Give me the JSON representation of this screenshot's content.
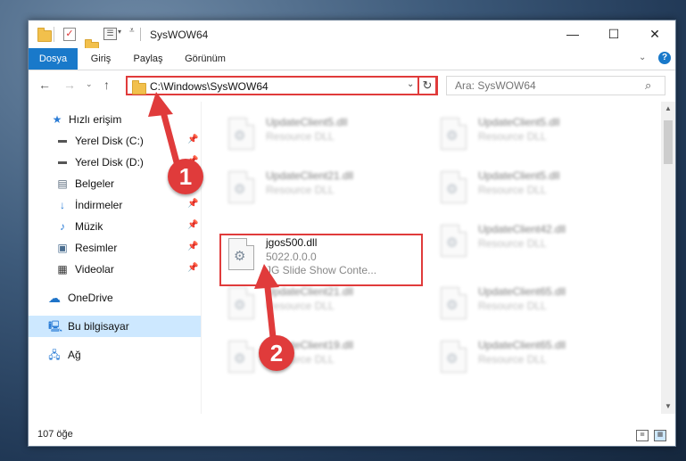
{
  "window": {
    "title": "SysWOW64",
    "controls": {
      "minimize": "—",
      "maximize": "☐",
      "close": "✕"
    }
  },
  "ribbon": {
    "tabs": [
      {
        "label": "Dosya",
        "active": true
      },
      {
        "label": "Giriş"
      },
      {
        "label": "Paylaş"
      },
      {
        "label": "Görünüm"
      }
    ],
    "help": "?"
  },
  "toolbar": {
    "address": "C:\\Windows\\SysWOW64",
    "search_placeholder": "Ara: SysWOW64"
  },
  "nav": {
    "items": [
      {
        "label": "Hızlı erişim",
        "icon": "star-icon"
      },
      {
        "label": "Yerel Disk (C:)",
        "icon": "drive-icon",
        "pinned": true
      },
      {
        "label": "Yerel Disk (D:)",
        "icon": "drive-icon",
        "pinned": true
      },
      {
        "label": "Belgeler",
        "icon": "document-icon",
        "pinned": true
      },
      {
        "label": "İndirmeler",
        "icon": "download-icon",
        "pinned": true
      },
      {
        "label": "Müzik",
        "icon": "music-icon",
        "pinned": true
      },
      {
        "label": "Resimler",
        "icon": "pictures-icon",
        "pinned": true
      },
      {
        "label": "Videolar",
        "icon": "video-icon",
        "pinned": true
      },
      {
        "label": "OneDrive",
        "icon": "cloud-icon"
      },
      {
        "label": "Bu bilgisayar",
        "icon": "computer-icon",
        "selected": true
      },
      {
        "label": "Ağ",
        "icon": "network-icon"
      }
    ]
  },
  "files": [
    {
      "name": "UpdateClient5.dll",
      "desc": "Resource DLL"
    },
    {
      "name": "UpdateClient5.dll",
      "desc": "Resource DLL"
    },
    {
      "name": "UpdateClient21.dll",
      "desc": "Resource DLL"
    },
    {
      "name": "UpdateClient5.dll",
      "desc": "Resource DLL"
    },
    {
      "name": "jgos500.dll",
      "desc": "5022.0.0.0",
      "desc2": "JG Slide Show Conte...",
      "highlighted": true
    },
    {
      "name": "UpdateClient42.dll",
      "desc": "Resource DLL"
    },
    {
      "name": "UpdateClient21.dll",
      "desc": "Resource DLL"
    },
    {
      "name": "UpdateClient65.dll",
      "desc": "Resource DLL"
    },
    {
      "name": "UpdateClient19.dll",
      "desc": "Resource DLL"
    },
    {
      "name": "UpdateClient65.dll",
      "desc": "Resource DLL"
    }
  ],
  "status": {
    "count": "107 öğe"
  },
  "annotations": {
    "step1": "1",
    "step2": "2",
    "color": "#e03b3b"
  }
}
